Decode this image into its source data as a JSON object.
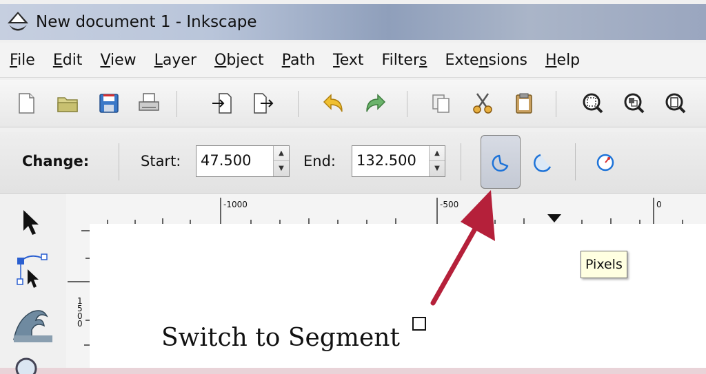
{
  "window": {
    "title": "New document 1 - Inkscape"
  },
  "menu": [
    {
      "pre": "",
      "ul": "F",
      "post": "ile"
    },
    {
      "pre": "",
      "ul": "E",
      "post": "dit"
    },
    {
      "pre": "",
      "ul": "V",
      "post": "iew"
    },
    {
      "pre": "",
      "ul": "L",
      "post": "ayer"
    },
    {
      "pre": "",
      "ul": "O",
      "post": "bject"
    },
    {
      "pre": "",
      "ul": "P",
      "post": "ath"
    },
    {
      "pre": "",
      "ul": "T",
      "post": "ext"
    },
    {
      "pre": "Filter",
      "ul": "s",
      "post": ""
    },
    {
      "pre": "Exte",
      "ul": "n",
      "post": "sions"
    },
    {
      "pre": "",
      "ul": "H",
      "post": "elp"
    }
  ],
  "controls": {
    "change_label": "Change:",
    "start_label": "Start:",
    "start_value": "47.500",
    "end_label": "End:",
    "end_value": "132.500"
  },
  "ruler": {
    "h_labels": [
      "-1000",
      "-500",
      "0"
    ],
    "v_label": "1500"
  },
  "tooltip": "Pixels",
  "annotation": "Switch to Segment",
  "colors": {
    "arrow": "#b5203a",
    "accent": "#1e73d8"
  }
}
